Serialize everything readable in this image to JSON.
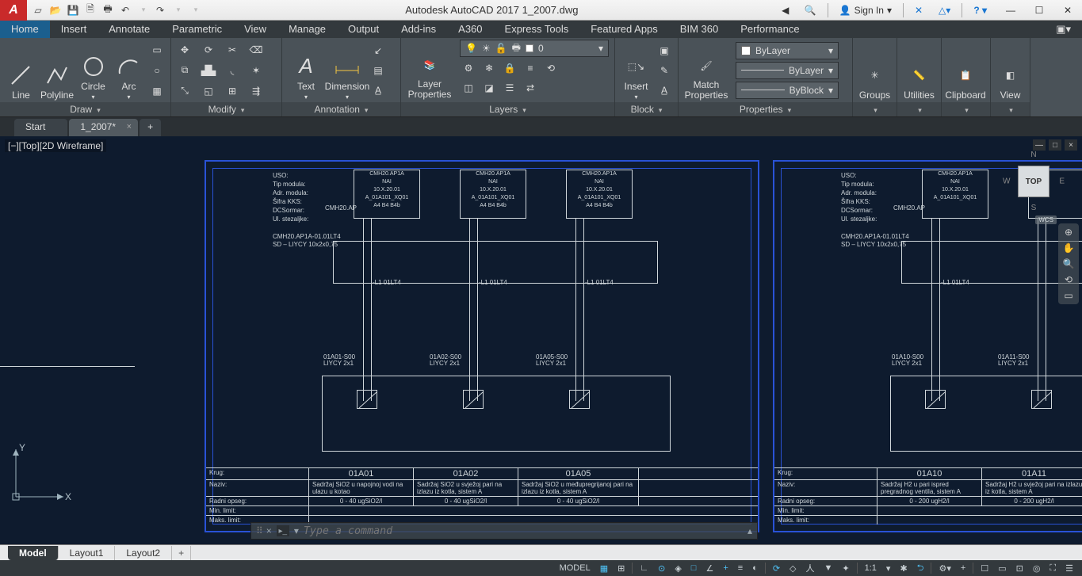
{
  "title": "Autodesk AutoCAD 2017   1_2007.dwg",
  "signin": "Sign In",
  "menu": [
    "Home",
    "Insert",
    "Annotate",
    "Parametric",
    "View",
    "Manage",
    "Output",
    "Add-ins",
    "A360",
    "Express Tools",
    "Featured Apps",
    "BIM 360",
    "Performance"
  ],
  "draw": {
    "line": "Line",
    "polyline": "Polyline",
    "circle": "Circle",
    "arc": "Arc",
    "title": "Draw"
  },
  "modify": {
    "title": "Modify"
  },
  "annotation": {
    "text": "Text",
    "dimension": "Dimension",
    "title": "Annotation"
  },
  "layers": {
    "btn": "Layer\nProperties",
    "title": "Layers",
    "current": "0"
  },
  "block": {
    "insert": "Insert",
    "title": "Block"
  },
  "props": {
    "match": "Match\nProperties",
    "bylayer": "ByLayer",
    "byblock": "ByBlock",
    "title": "Properties"
  },
  "groups": "Groups",
  "utilities": "Utilities",
  "clipboard": "Clipboard",
  "view": "View",
  "filetabs": {
    "start": "Start",
    "doc": "1_2007*"
  },
  "viewlabel": "[−][Top][2D Wireframe]",
  "viewcube": {
    "top": "TOP",
    "n": "N",
    "s": "S",
    "e": "E",
    "w": "W",
    "wcs": "WCS"
  },
  "ucs": {
    "x": "X",
    "y": "Y"
  },
  "module_labels": {
    "uso": "USO:",
    "tip": "Tip modula:",
    "adr": "Adr. modula:",
    "sifra": "Šifra KKS:",
    "dcs": "DCSormar:",
    "ul": "Ul. stezaljke:",
    "dcsval": "CMH20.AP"
  },
  "col_head": [
    "CMH20.AP1A",
    "NAI",
    "10.X.20.01",
    "A_01A101_XQ01",
    "A4    B4    B4b"
  ],
  "cable1": "CMH20.AP1A-01.01LT4",
  "cable2": "SD – LIYCY 10x2x0,75",
  "lt4": "-L1  01LT4",
  "mid_a": "01A01-S00",
  "mid_b": "LIYCY 2x1",
  "mid_list": [
    "01A01-S00",
    "01A02-S00",
    "01A05-S00",
    "01A10-S00",
    "01A11-S00"
  ],
  "tb": {
    "krug": "Krug:",
    "naziv": "Naziv:",
    "radni": "Radni opseg:",
    "min": "Min. limit:",
    "maks": "Maks. limit:",
    "codes": [
      "01A01",
      "01A02",
      "01A05",
      "01A10",
      "01A11"
    ],
    "desc": [
      "Sadržaj SiO2 u napojnoj vodi na ulazu u kotao",
      "Sadržaj SiO2 u svježoj pari na izlazu iz kotla, sistem A",
      "Sadržaj SiO2 u međupregrijanoj pari na izlazu iz kotla, sistem A",
      "Sadržaj H2 u pari ispred pregradnog ventila, sistem A",
      "Sadržaj H2 u svježoj pari na izlazu iz kotla, sistem A"
    ],
    "range": [
      "0 - 40  ugSiO2/l",
      "0 - 40  ugSiO2/l",
      "0 - 40  ugSiO2/l",
      "0 - 200  ugH2/l",
      "0 - 200  ugH2/l"
    ]
  },
  "cmd_placeholder": "Type a command",
  "layout": {
    "model": "Model",
    "l1": "Layout1",
    "l2": "Layout2"
  },
  "status": {
    "model": "MODEL",
    "scale": "1:1"
  }
}
